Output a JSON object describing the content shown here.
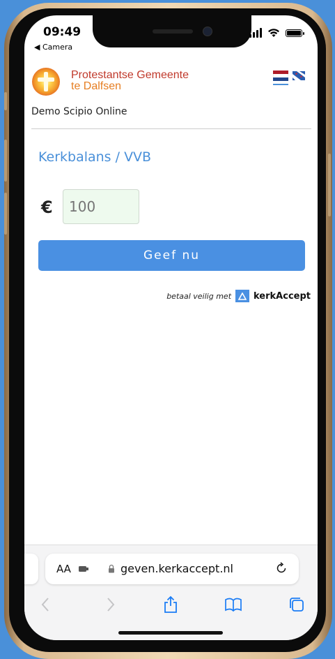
{
  "status_bar": {
    "time": "09:49",
    "back_label": "◀ Camera"
  },
  "site": {
    "name_line1": "Protestantse Gemeente",
    "name_line2": "te Dalfsen",
    "org_label": "Demo Scipio Online"
  },
  "form": {
    "fund_title": "Kerkbalans / VVB",
    "currency_symbol": "€",
    "amount_placeholder": "100",
    "submit_label": "Geef nu"
  },
  "footer": {
    "secure_text": "betaal veilig met",
    "provider_name": "kerkAccept"
  },
  "browser": {
    "text_size_label": "AA",
    "url": "geven.kerkaccept.nl"
  },
  "colors": {
    "background": "#4a90d9",
    "accent": "#4a90e2",
    "brand_red": "#c0392b",
    "brand_orange": "#e67e22",
    "input_bg": "#eefaee"
  },
  "icons": [
    "signal-icon",
    "wifi-icon",
    "battery-icon",
    "church-logo",
    "flag-nl-icon",
    "flag-fy-icon",
    "kerkaccept-logo-icon",
    "extension-icon",
    "lock-icon",
    "reload-icon",
    "back-icon",
    "forward-icon",
    "share-icon",
    "bookmarks-icon",
    "tabs-icon"
  ]
}
